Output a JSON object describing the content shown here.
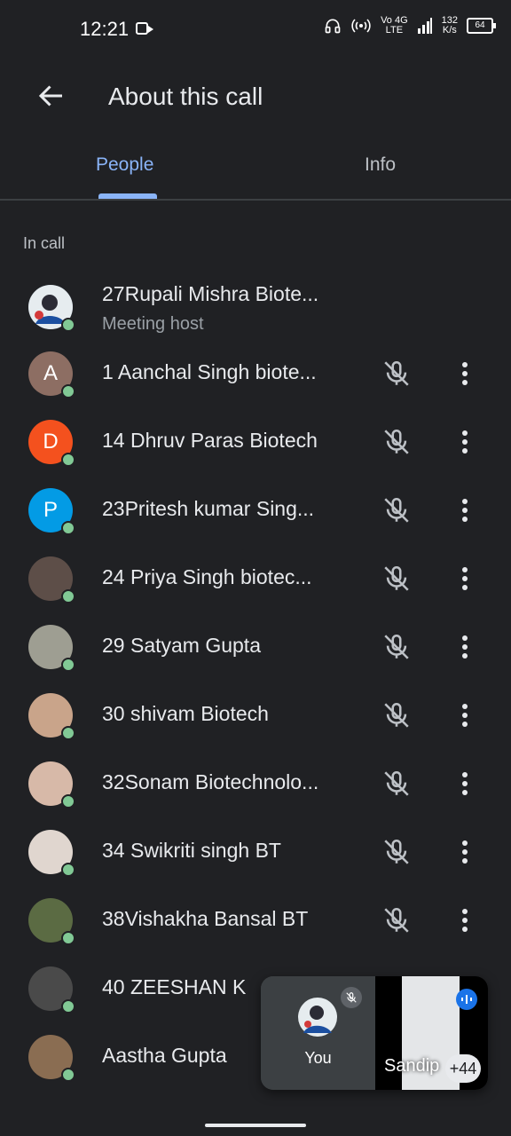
{
  "status": {
    "time": "12:21",
    "net_top": "Vo 4G",
    "net_bottom": "LTE",
    "speed_top": "132",
    "speed_bottom": "K/s",
    "battery": "64"
  },
  "appbar": {
    "title": "About this call"
  },
  "tabs": {
    "people": "People",
    "info": "Info"
  },
  "section": {
    "in_call": "In call"
  },
  "host": {
    "name": "27Rupali Mishra Biote...",
    "role": "Meeting host"
  },
  "participants": [
    {
      "name": "1 Aanchal Singh biote...",
      "initial": "A",
      "color": "#8d6e63"
    },
    {
      "name": "14 Dhruv Paras Biotech",
      "initial": "D",
      "color": "#f4511e"
    },
    {
      "name": "23Pritesh kumar Sing...",
      "initial": "P",
      "color": "#039be5"
    },
    {
      "name": "24 Priya Singh biotec...",
      "initial": "",
      "color": "#5d4e48"
    },
    {
      "name": "29 Satyam Gupta",
      "initial": "",
      "color": "#9e9e92"
    },
    {
      "name": "30 shivam Biotech",
      "initial": "",
      "color": "#c9a48a"
    },
    {
      "name": "32Sonam Biotechnolo...",
      "initial": "",
      "color": "#d7b9a8"
    },
    {
      "name": "34 Swikriti singh BT",
      "initial": "",
      "color": "#e0d6cf"
    },
    {
      "name": "38Vishakha Bansal BT",
      "initial": "",
      "color": "#5b6b43"
    },
    {
      "name": "40 ZEESHAN K",
      "initial": "",
      "color": "#4a4a4a"
    },
    {
      "name": "Aastha Gupta",
      "initial": "",
      "color": "#8a6d52"
    }
  ],
  "pip": {
    "you_label": "You",
    "other_label": "Sandip",
    "more_count": "+44"
  }
}
